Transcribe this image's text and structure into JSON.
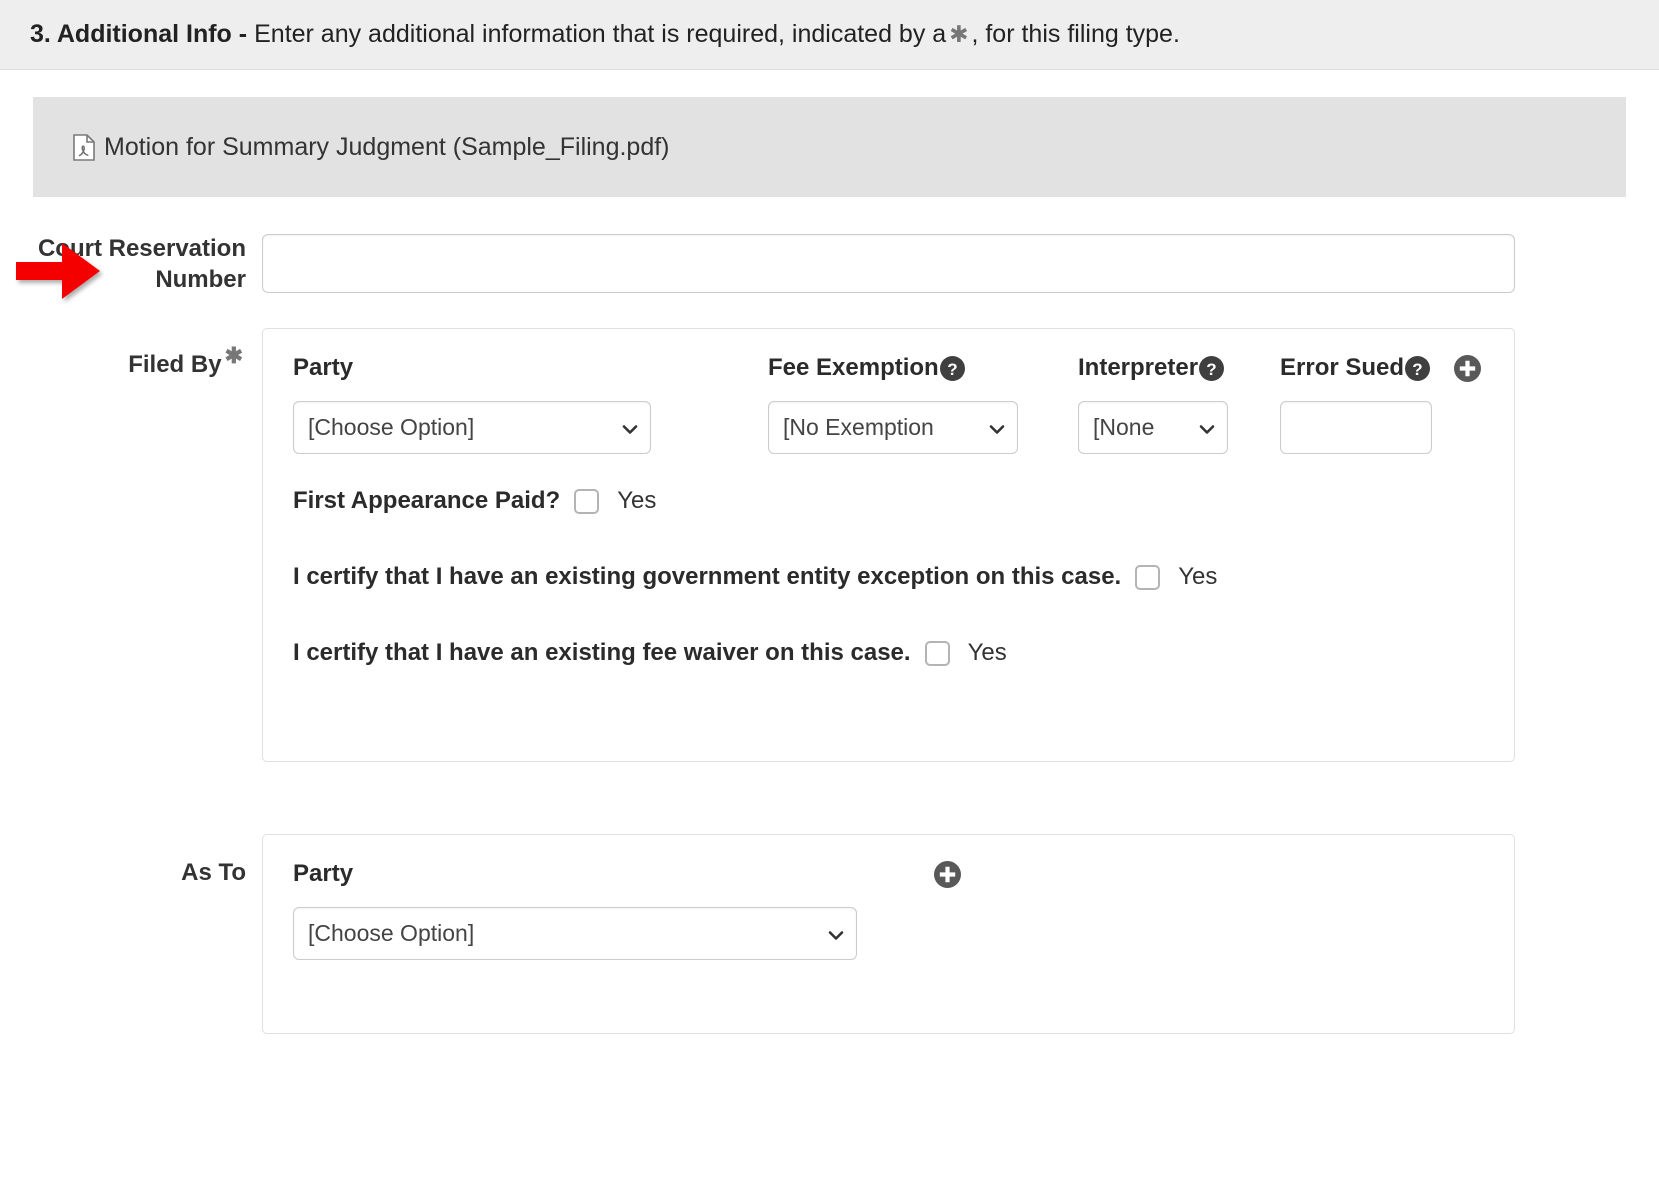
{
  "section": {
    "number": "3. Additional Info -",
    "description_before": "Enter any additional information that is required, indicated by a",
    "star": "✱",
    "description_after": ", for this filing type."
  },
  "attachment": {
    "icon": "pdf-file-icon",
    "label": "Motion for Summary Judgment (Sample_Filing.pdf)"
  },
  "court_reservation": {
    "label": "Court Reservation Number",
    "value": "",
    "placeholder": ""
  },
  "annotation": {
    "arrow": "red-right-arrow",
    "color": "#f40000",
    "points_to": "Court Reservation Number"
  },
  "filed_by": {
    "label": "Filed By",
    "required_marker": "✱",
    "columns": {
      "party": {
        "header": "Party",
        "selected": "[Choose Option]"
      },
      "fee_exemption": {
        "header": "Fee Exemption",
        "help": "?",
        "selected": "[No Exemption"
      },
      "interpreter": {
        "header": "Interpreter",
        "help": "?",
        "selected": "[None"
      },
      "error_sued": {
        "header": "Error Sued",
        "help": "?",
        "value": ""
      }
    },
    "add_button": "+",
    "checkboxes": [
      {
        "label": "First Appearance Paid?",
        "checked": false,
        "yes_label": "Yes"
      },
      {
        "label": "I certify that I have an existing government entity exception on this case.",
        "checked": false,
        "yes_label": "Yes"
      },
      {
        "label": "I certify that I have an existing fee waiver on this case.",
        "checked": false,
        "yes_label": "Yes"
      }
    ]
  },
  "as_to": {
    "label": "As To",
    "party": {
      "header": "Party",
      "selected": "[Choose Option]"
    },
    "add_button": "+"
  },
  "colors": {
    "header_bg": "#eeeeee",
    "attachment_bg": "#e2e2e2",
    "page_bg": "#ffffff",
    "text": "#333333",
    "border": "#cccccc",
    "icon_dark": "#4a4a4a",
    "arrow_red": "#f40000"
  }
}
